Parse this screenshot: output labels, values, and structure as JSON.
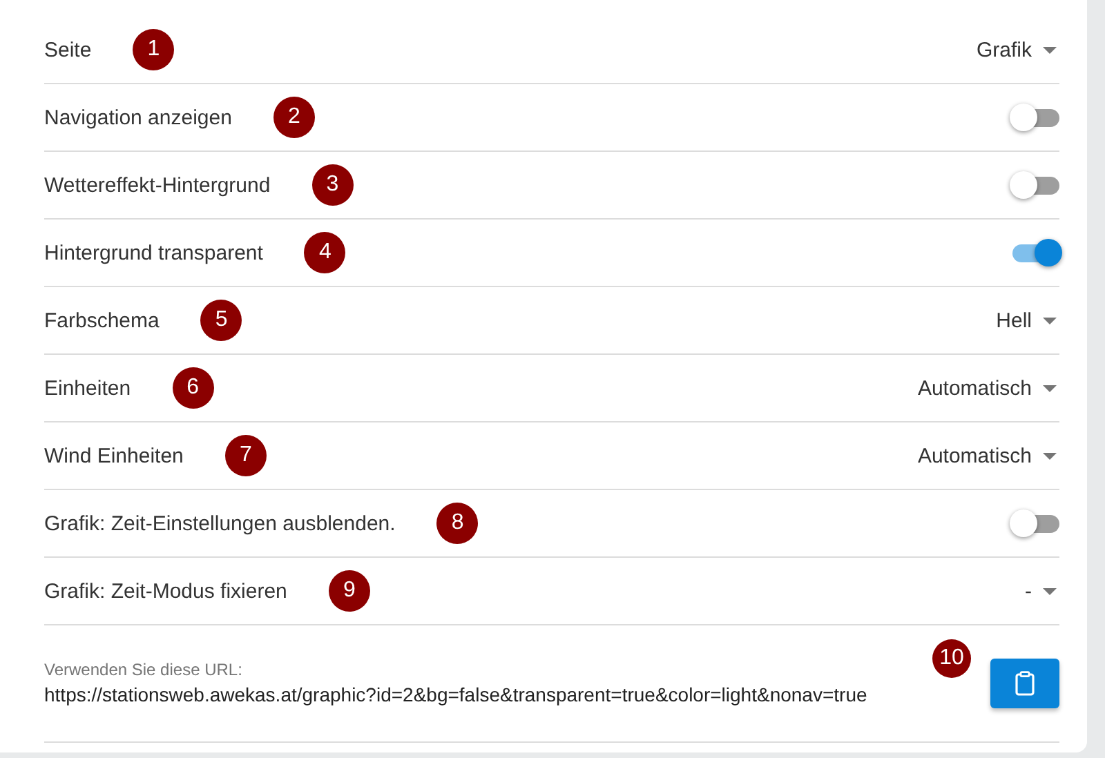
{
  "settings": [
    {
      "label": "Seite",
      "badge": "1",
      "kind": "select",
      "value": "Grafik"
    },
    {
      "label": "Navigation anzeigen",
      "badge": "2",
      "kind": "toggle",
      "on": false
    },
    {
      "label": "Wettereffekt-Hintergrund",
      "badge": "3",
      "kind": "toggle",
      "on": false
    },
    {
      "label": "Hintergrund transparent",
      "badge": "4",
      "kind": "toggle",
      "on": true
    },
    {
      "label": "Farbschema",
      "badge": "5",
      "kind": "select",
      "value": "Hell"
    },
    {
      "label": "Einheiten",
      "badge": "6",
      "kind": "select",
      "value": "Automatisch"
    },
    {
      "label": "Wind Einheiten",
      "badge": "7",
      "kind": "select",
      "value": "Automatisch"
    },
    {
      "label": "Grafik: Zeit-Einstellungen ausblenden.",
      "badge": "8",
      "kind": "toggle",
      "on": false
    },
    {
      "label": "Grafik: Zeit-Modus fixieren",
      "badge": "9",
      "kind": "select",
      "value": "-"
    }
  ],
  "url_field": {
    "label": "Verwenden Sie diese URL:",
    "value": "https://stationsweb.awekas.at/graphic?id=2&bg=false&transparent=true&color=light&nonav=true",
    "badge": "10"
  }
}
